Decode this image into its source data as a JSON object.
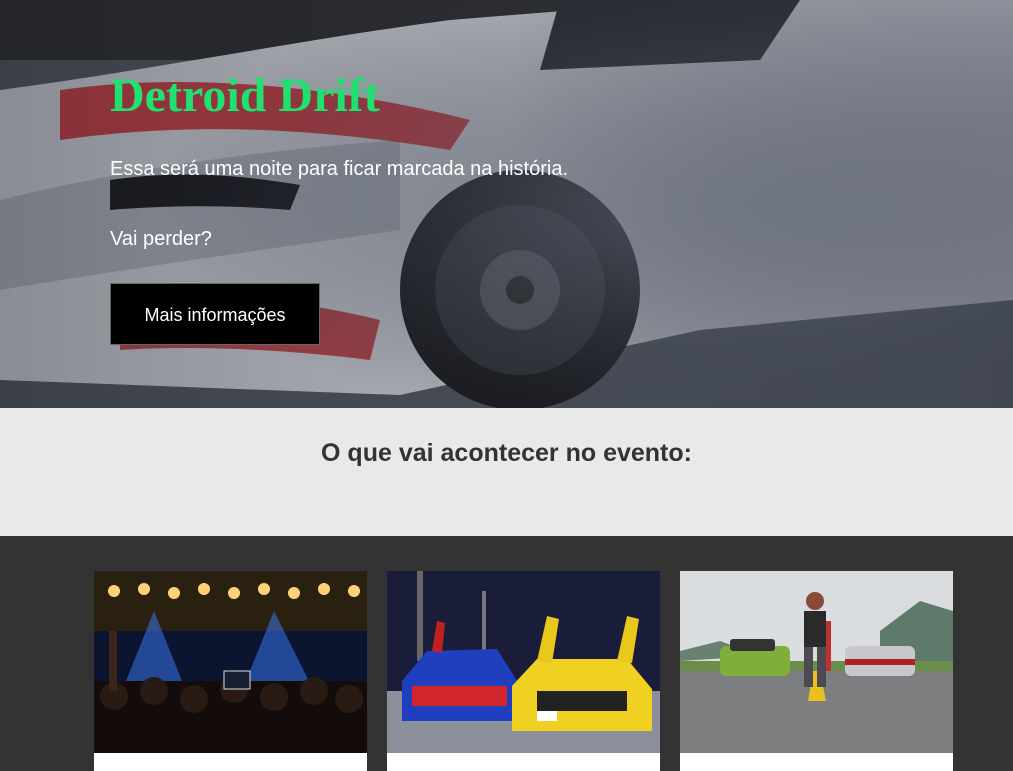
{
  "hero": {
    "title": "Detroid Drift",
    "line1": "Essa será uma noite para ficar marcada na história.",
    "line2": "Vai perder?",
    "button_label": "Mais informações",
    "title_color": "#20e070"
  },
  "section": {
    "heading": "O que vai acontecer no evento:"
  },
  "cards": [
    {
      "image": "concert-crowd-photo"
    },
    {
      "image": "tuned-cars-night-photo"
    },
    {
      "image": "muscle-cars-road-photo"
    }
  ]
}
